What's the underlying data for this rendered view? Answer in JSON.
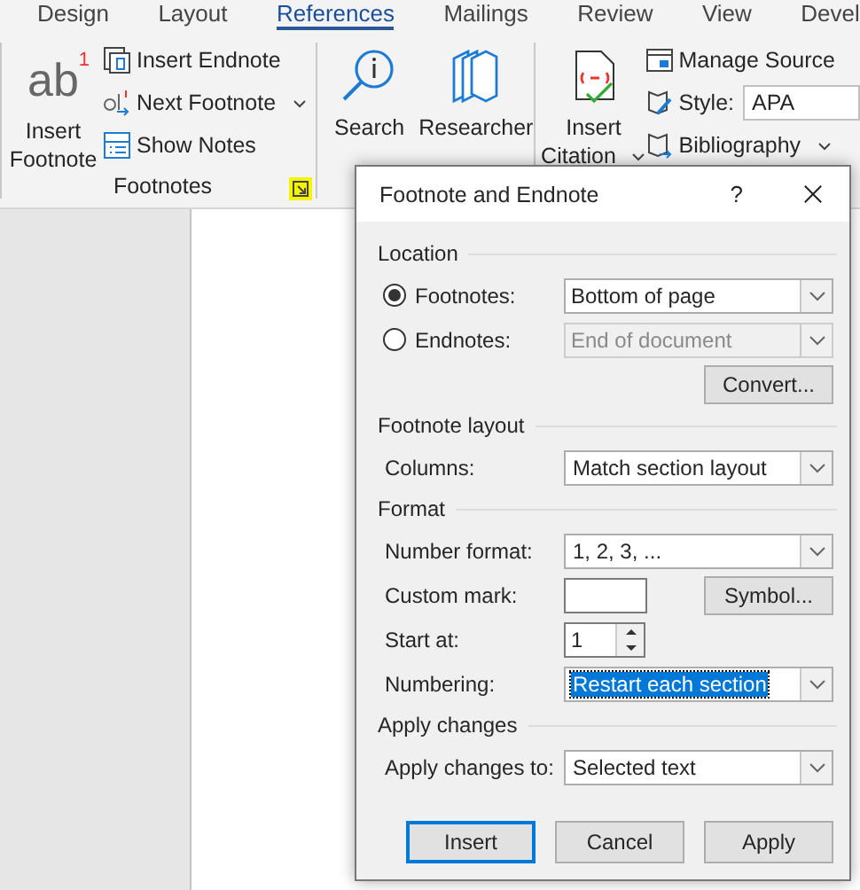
{
  "ribbon": {
    "tabs": [
      {
        "label": "Design",
        "selected": false
      },
      {
        "label": "Layout",
        "selected": false
      },
      {
        "label": "References",
        "selected": true
      },
      {
        "label": "Mailings",
        "selected": false
      },
      {
        "label": "Review",
        "selected": false
      },
      {
        "label": "View",
        "selected": false
      },
      {
        "label": "Devel",
        "selected": false
      }
    ],
    "footnotes_group": {
      "insert_footnote": {
        "glyph": "ab",
        "mark": "1",
        "label_1": "Insert",
        "label_2": "Footnote"
      },
      "small_buttons": [
        {
          "label": "Insert Endnote",
          "kind": "endnote",
          "caret": false
        },
        {
          "label": "Next Footnote",
          "kind": "next",
          "caret": true
        },
        {
          "label": "Show Notes",
          "kind": "notes",
          "caret": false
        }
      ],
      "label": "Footnotes",
      "launcher_highlighted": true
    },
    "research_group": {
      "buttons": [
        {
          "label": "Search",
          "kind": "search"
        },
        {
          "label": "Researcher",
          "kind": "books"
        }
      ]
    },
    "citations_group": {
      "insert_citation": {
        "label_1": "Insert",
        "label_2": "Citation"
      },
      "manage_sources": "Manage Source",
      "style_label": "Style:",
      "style_value": "APA",
      "bibliography": "Bibliography"
    }
  },
  "dialog": {
    "title": "Footnote and Endnote",
    "help": "?",
    "sections": [
      {
        "title": "Location",
        "rows": [
          {
            "kind": "radio",
            "label": "Footnotes:",
            "selected": true,
            "value": "Bottom of page",
            "disabled": false
          },
          {
            "kind": "radio",
            "label": "Endnotes:",
            "selected": false,
            "value": "End of document",
            "disabled": true
          },
          {
            "kind": "button",
            "button": "Convert..."
          }
        ]
      },
      {
        "title": "Footnote layout",
        "rows": [
          {
            "kind": "select",
            "label": "Columns:",
            "value": "Match section layout",
            "focused": false
          }
        ]
      },
      {
        "title": "Format",
        "rows": [
          {
            "kind": "select",
            "label": "Number format:",
            "value": "1, 2, 3, ...",
            "focused": false
          },
          {
            "kind": "input",
            "label": "Custom mark:",
            "button": "Symbol..."
          },
          {
            "kind": "spinner",
            "label": "Start at:",
            "value": "1"
          },
          {
            "kind": "select",
            "label": "Numbering:",
            "value": "Restart each section",
            "focused": true
          }
        ]
      },
      {
        "title": "Apply changes",
        "rows": [
          {
            "kind": "select",
            "label": "Apply changes to:",
            "value": "Selected text",
            "focused": false
          }
        ]
      }
    ],
    "buttons": [
      {
        "label": "Insert",
        "default": true
      },
      {
        "label": "Cancel",
        "default": false
      },
      {
        "label": "Apply",
        "default": false
      }
    ]
  }
}
